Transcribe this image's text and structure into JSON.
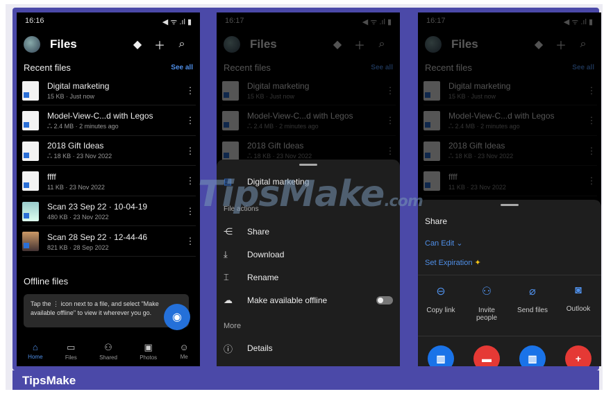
{
  "screen1": {
    "status_time": "16:16",
    "status_icons": "◀ ᯤ .ıl ▮",
    "title": "Files",
    "recent_label": "Recent files",
    "see_all": "See all",
    "files": [
      {
        "name": "Digital marketing",
        "meta": "15 KB · Just now",
        "kind": "doc"
      },
      {
        "name": "Model-View-C...d with Legos",
        "meta": "ஃ 2.4 MB · 2 minutes ago",
        "kind": "ppt"
      },
      {
        "name": "2018 Gift Ideas",
        "meta": "ஃ 18 KB · 23 Nov 2022",
        "kind": "doc"
      },
      {
        "name": "ffff",
        "meta": "11 KB · 23 Nov 2022",
        "kind": "doc"
      },
      {
        "name": "Scan 23 Sep 22 · 10-04-19",
        "meta": "480 KB · 23 Nov 2022",
        "kind": "img"
      },
      {
        "name": "Scan 28 Sep 22 · 12-44-46",
        "meta": "821 KB · 28 Sep 2022",
        "kind": "photo"
      }
    ],
    "offline_label": "Offline files",
    "tip_text": "Tap the ⋮ icon next to a file, and select \"Make available offline\" to view it wherever you go.",
    "nav": [
      {
        "label": "Home",
        "icon": "home-icon",
        "glyph": "⌂",
        "active": true
      },
      {
        "label": "Files",
        "icon": "folder-icon",
        "glyph": "▭",
        "active": false
      },
      {
        "label": "Shared",
        "icon": "shared-icon",
        "glyph": "⚇",
        "active": false
      },
      {
        "label": "Photos",
        "icon": "photos-icon",
        "glyph": "▣",
        "active": false
      },
      {
        "label": "Me",
        "icon": "person-icon",
        "glyph": "☺",
        "active": false
      }
    ]
  },
  "screen2": {
    "status_time": "16:17",
    "title": "Files",
    "recent_label": "Recent files",
    "see_all": "See all",
    "sheet_file": "Digital marketing",
    "file_actions_label": "File actions",
    "actions": [
      {
        "label": "Share",
        "glyph": "⋲",
        "icon": "share-icon"
      },
      {
        "label": "Download",
        "glyph": "⤓",
        "icon": "download-icon"
      },
      {
        "label": "Rename",
        "glyph": "⌶",
        "icon": "rename-icon"
      },
      {
        "label": "Make available offline",
        "glyph": "☁",
        "icon": "offline-icon"
      }
    ],
    "more_label": "More",
    "details_label": "Details"
  },
  "screen3": {
    "status_time": "16:17",
    "title": "Files",
    "share_label": "Share",
    "can_edit": "Can Edit ⌄",
    "set_expiration": "Set Expiration",
    "premium_mark": "✦",
    "share_options": [
      {
        "label": "Copy link",
        "glyph": "⊖",
        "icon": "link-icon"
      },
      {
        "label": "Invite people",
        "glyph": "⚇",
        "icon": "invite-icon"
      },
      {
        "label": "Send files",
        "glyph": "⌀",
        "icon": "attach-icon"
      },
      {
        "label": "Outlook",
        "glyph": "◙",
        "icon": "outlook-icon"
      }
    ],
    "apps": [
      {
        "glyph": "▥",
        "color": "#1a73e8"
      },
      {
        "glyph": "▬",
        "color": "#e53935"
      },
      {
        "glyph": "▥",
        "color": "#1a73e8"
      },
      {
        "glyph": "+",
        "color": "#e53935"
      }
    ]
  },
  "watermark": {
    "text": "TipsMake",
    "suffix": ".com"
  },
  "brand": "TipsMake"
}
